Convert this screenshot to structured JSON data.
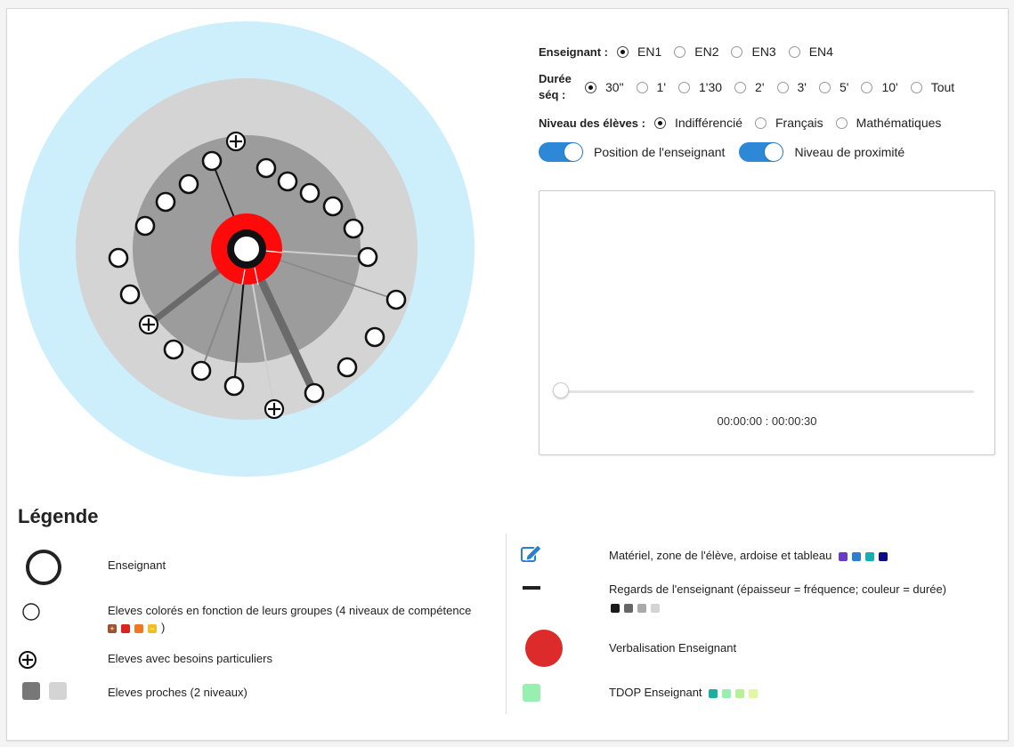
{
  "controls": {
    "teacher_label": "Enseignant :",
    "teachers": [
      {
        "label": "EN1",
        "selected": true
      },
      {
        "label": "EN2",
        "selected": false
      },
      {
        "label": "EN3",
        "selected": false
      },
      {
        "label": "EN4",
        "selected": false
      }
    ],
    "duration_label_1": "Durée",
    "duration_label_2": "séq :",
    "durations": [
      {
        "label": "30\"",
        "selected": true
      },
      {
        "label": "1'",
        "selected": false
      },
      {
        "label": "1'30",
        "selected": false
      },
      {
        "label": "2'",
        "selected": false
      },
      {
        "label": "3'",
        "selected": false
      },
      {
        "label": "5'",
        "selected": false
      },
      {
        "label": "10'",
        "selected": false
      },
      {
        "label": "Tout",
        "selected": false
      }
    ],
    "level_label": "Niveau des élèves :",
    "levels": [
      {
        "label": "Indifférencié",
        "selected": true
      },
      {
        "label": "Français",
        "selected": false
      },
      {
        "label": "Mathématiques",
        "selected": false
      }
    ],
    "toggle_position_label": "Position de l'enseignant",
    "toggle_proximity_label": "Niveau de proximité",
    "time_display": "00:00:00 : 00:00:30",
    "slider_value": 0
  },
  "legend": {
    "title": "Légende",
    "teacher": "Enseignant",
    "students_line1": "Eleves colorés en fonction de leurs groupes (4 niveaux de compétence",
    "students_close_paren": ")",
    "special_needs": "Eleves avec besoins particuliers",
    "close_students": "Eleves proches (2 niveaux)",
    "material": "Matériel, zone de l'élève, ardoise et tableau",
    "gaze": "Regards de l'enseignant (épaisseur = fréquence; couleur = durée)",
    "verbalisation": "Verbalisation Enseignant",
    "tdop": "TDOP Enseignant",
    "colors": {
      "competence": [
        "#a0522d",
        "#dd2222",
        "#f07820",
        "#f0c020"
      ],
      "material": [
        "#6a3dc8",
        "#2a7fd4",
        "#12b0b0",
        "#0a0a8a"
      ],
      "gaze": [
        "#1a1a1a",
        "#666666",
        "#aaaaaa",
        "#d4d4d4"
      ],
      "tdop": [
        "#1ab0a0",
        "#98f0b0",
        "#b8f09a",
        "#e0f8a0"
      ],
      "verbal": "#dd2a2a",
      "outer_zone": "#cdeffb",
      "mid_zone": "#d4d4d4",
      "inner_zone": "#9c9c9c",
      "edit_icon": "#2a7fd4"
    }
  }
}
